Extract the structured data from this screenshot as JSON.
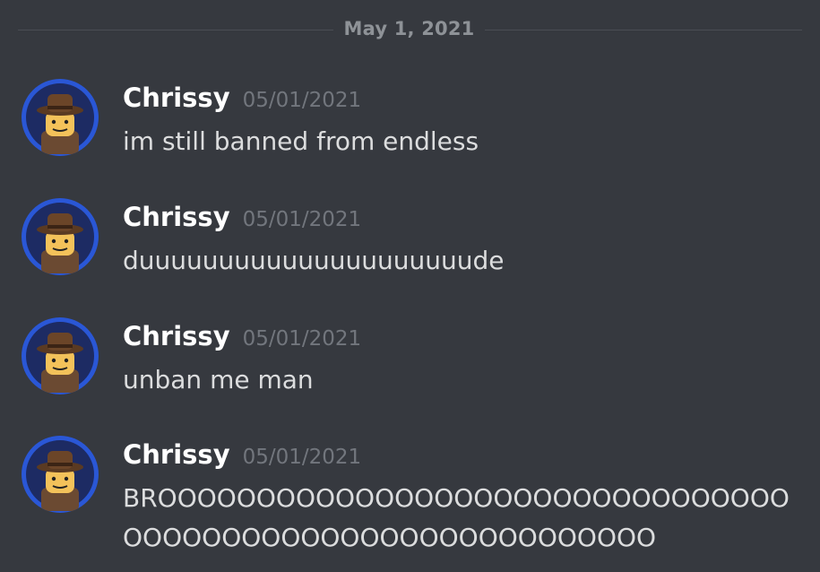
{
  "divider": {
    "date": "May 1, 2021"
  },
  "messages": [
    {
      "username": "Chrissy",
      "timestamp": "05/01/2021",
      "text": "im still banned from endless"
    },
    {
      "username": "Chrissy",
      "timestamp": "05/01/2021",
      "text": "duuuuuuuuuuuuuuuuuuuuude"
    },
    {
      "username": "Chrissy",
      "timestamp": "05/01/2021",
      "text": "unban me man"
    },
    {
      "username": "Chrissy",
      "timestamp": "05/01/2021",
      "text": "BROOOOOOOOOOOOOOOOOOOOOOOOOOOOOOOOOOOOOOOOOOOOOOOOOOOOOOOOOOO"
    }
  ],
  "colors": {
    "background": "#36393f",
    "avatar_ring": "#2a57d6",
    "username": "#ffffff",
    "timestamp": "#72767d",
    "message_text": "#dcddde"
  },
  "icons": {
    "avatar": "lego-minifigure-avatar-icon"
  }
}
